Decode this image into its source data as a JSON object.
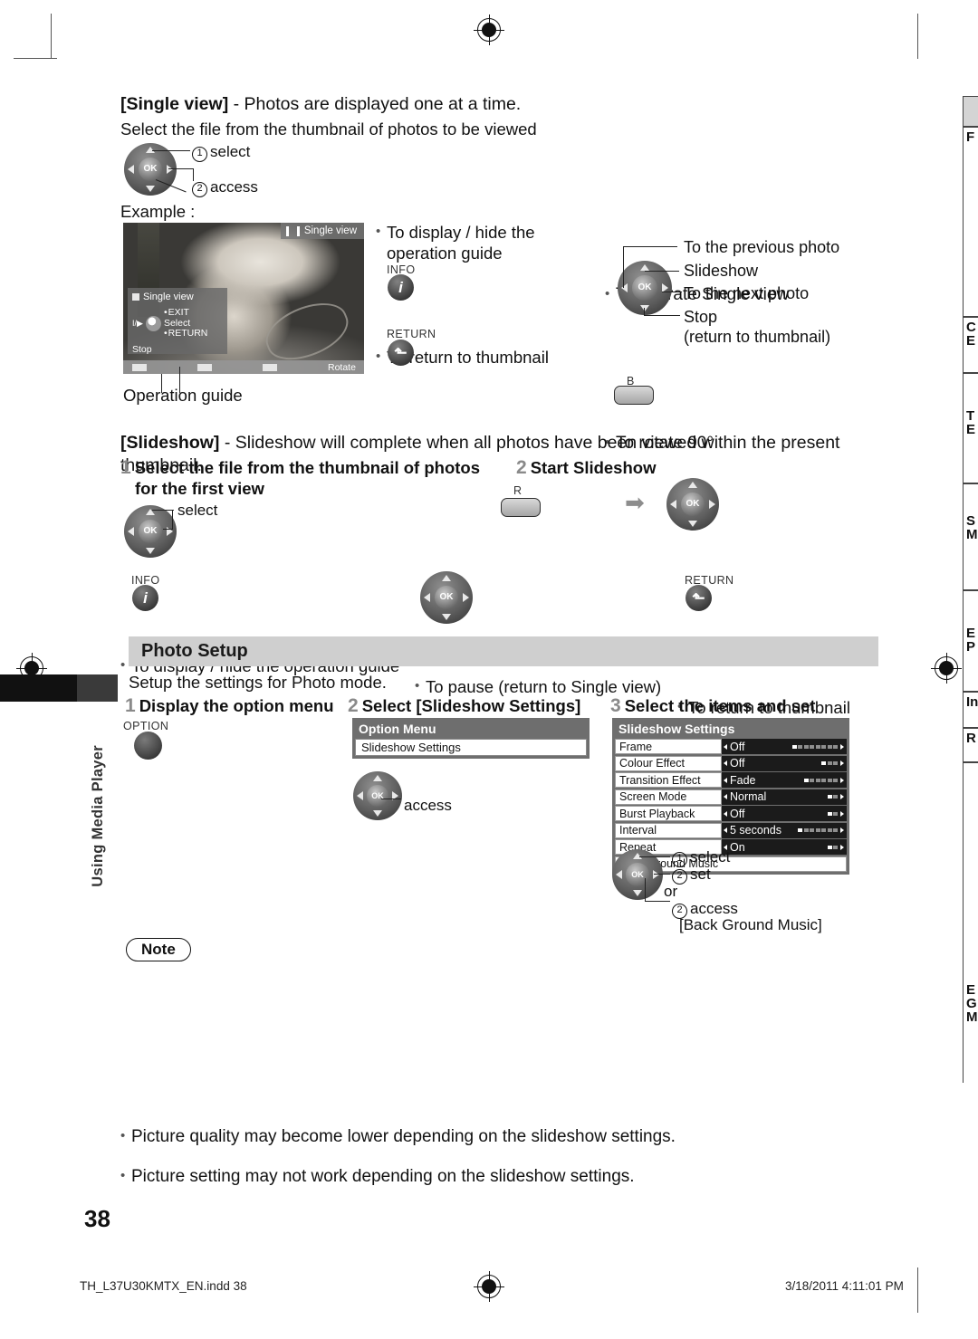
{
  "page": {
    "number": "38",
    "side_tab": "Using Media Player"
  },
  "single_view": {
    "heading_bracket": "[Single view]",
    "heading_rest": " - Photos are displayed one at a time.",
    "instruction": "Select the file from the thumbnail of photos to be viewed",
    "callout_select": "select",
    "callout_access": "access",
    "example_label": "Example :",
    "operation_guide_caption": "Operation guide"
  },
  "tv_screen": {
    "status_label": "Single view",
    "pause_icon": "pause-icon",
    "guide_title": "Single view",
    "guide_exit": "EXIT",
    "guide_select": "Select",
    "guide_return": "RETURN",
    "guide_playmark": "I/▶",
    "guide_stop": "Stop",
    "bottom_rotate": "Rotate"
  },
  "single_view_tips": {
    "display_hide": "To display / hide the",
    "display_hide2": "operation guide",
    "info_label": "INFO",
    "info_icon": "info-icon",
    "return_thumb": "To return to thumbnail",
    "return_label": "RETURN",
    "return_icon": "return-icon"
  },
  "operate_single_view": {
    "title": "To operate Single view",
    "prev_photo": "To the previous photo",
    "slideshow": "Slideshow",
    "next_photo": "To the next photo",
    "stop": "Stop",
    "stop_sub": "(return to thumbnail)",
    "rotate": "To rotate 90°",
    "rotate_button": "B"
  },
  "slideshow": {
    "heading_bracket": "[Slideshow]",
    "heading_rest": " - Slideshow will complete when all photos have been viewed within the present thumbnail.",
    "step1_num": "1",
    "step1_text": "Select the file from the thumbnail of photos",
    "step1_text2": "for the first view",
    "step1_callout": "select",
    "step2_num": "2",
    "step2_text": "Start Slideshow",
    "step2_button": "R",
    "tip1": "To display / hide the operation guide",
    "tip1_label": "INFO",
    "tip2": "To pause (return to Single view)",
    "tip3": "To return to thumbnail",
    "tip3_label": "RETURN"
  },
  "photo_setup": {
    "section_title": "Photo Setup",
    "intro": "Setup the settings for Photo mode.",
    "step1_num": "1",
    "step1_text": "Display the option menu",
    "step1_button_label": "OPTION",
    "step2_num": "2",
    "step2_text": "Select [Slideshow Settings]",
    "step2_callout": "access",
    "step3_num": "3",
    "step3_text": "Select the items and set",
    "callout_select": "select",
    "callout_set": "set",
    "callout_or": "or",
    "callout_access": "access",
    "callout_bgm": "[Back Ground Music]"
  },
  "option_menu": {
    "title": "Option Menu",
    "items": [
      "Slideshow Settings"
    ]
  },
  "slideshow_settings": {
    "title": "Slideshow Settings",
    "rows": [
      {
        "name": "Frame",
        "value": "Off",
        "gauge_on": 1,
        "gauge_total": 8
      },
      {
        "name": "Colour Effect",
        "value": "Off",
        "gauge_on": 1,
        "gauge_total": 3
      },
      {
        "name": "Transition Effect",
        "value": "Fade",
        "gauge_on": 1,
        "gauge_total": 6
      },
      {
        "name": "Screen Mode",
        "value": "Normal",
        "gauge_on": 1,
        "gauge_total": 2
      },
      {
        "name": "Burst Playback",
        "value": "Off",
        "gauge_on": 1,
        "gauge_total": 2
      },
      {
        "name": "Interval",
        "value": "5 seconds",
        "gauge_on": 1,
        "gauge_total": 7
      },
      {
        "name": "Repeat",
        "value": "On",
        "gauge_on": 1,
        "gauge_total": 2
      }
    ],
    "last_row": "Back Ground Music"
  },
  "note": {
    "label": "Note",
    "items": [
      "Picture quality may become lower depending on the slideshow settings.",
      "Picture setting may not work depending on the slideshow settings."
    ]
  },
  "index_tabs": [
    {
      "lines": [
        ""
      ]
    },
    {
      "lines": [
        "F"
      ]
    },
    {
      "lines": [
        "C",
        "E"
      ]
    },
    {
      "lines": [
        "T",
        "E"
      ]
    },
    {
      "lines": [
        "S",
        "M"
      ]
    },
    {
      "lines": [
        "E",
        "P"
      ]
    },
    {
      "lines": [
        "In"
      ]
    },
    {
      "lines": [
        "R"
      ]
    },
    {
      "lines": [
        "E",
        "G",
        "M"
      ]
    }
  ],
  "footer": {
    "filename": "TH_L37U30KMTX_EN.indd   38",
    "timestamp": "3/18/2011   4:11:01 PM"
  }
}
